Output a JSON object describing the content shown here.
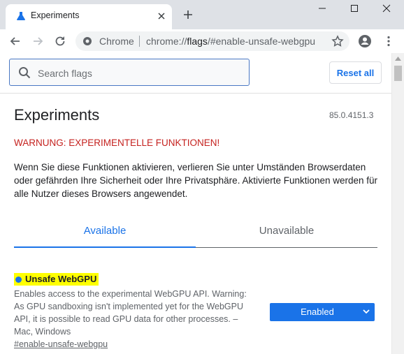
{
  "tab": {
    "title": "Experiments"
  },
  "toolbar": {
    "omnibox_site": "Chrome",
    "omnibox_url_prefix": "chrome://",
    "omnibox_url_host": "flags",
    "omnibox_url_path": "/#enable-unsafe-webgpu"
  },
  "header": {
    "search_placeholder": "Search flags",
    "reset_label": "Reset all"
  },
  "page": {
    "title": "Experiments",
    "version": "85.0.4151.3",
    "warning": "WARNUNG: EXPERIMENTELLE FUNKTIONEN!",
    "intro": "Wenn Sie diese Funktionen aktivieren, verlieren Sie unter Umständen Browserdaten oder gefährden Ihre Sicherheit oder Ihre Privatsphäre. Aktivierte Funktionen werden für alle Nutzer dieses Browsers angewendet."
  },
  "tabs": [
    {
      "label": "Available",
      "active": true
    },
    {
      "label": "Unavailable",
      "active": false
    }
  ],
  "flag": {
    "name": "Unsafe WebGPU",
    "description": "Enables access to the experimental WebGPU API. Warning: As GPU sandboxing isn't implemented yet for the WebGPU API, it is possible to read GPU data for other processes. – Mac, Windows",
    "link": "#enable-unsafe-webgpu",
    "selected_option": "Enabled"
  },
  "colors": {
    "accent": "#1a73e8",
    "warning": "#c5221f",
    "highlight": "#ffff00"
  },
  "icons": {
    "favicon": "flask-icon",
    "site": "chrome-logo-icon"
  }
}
